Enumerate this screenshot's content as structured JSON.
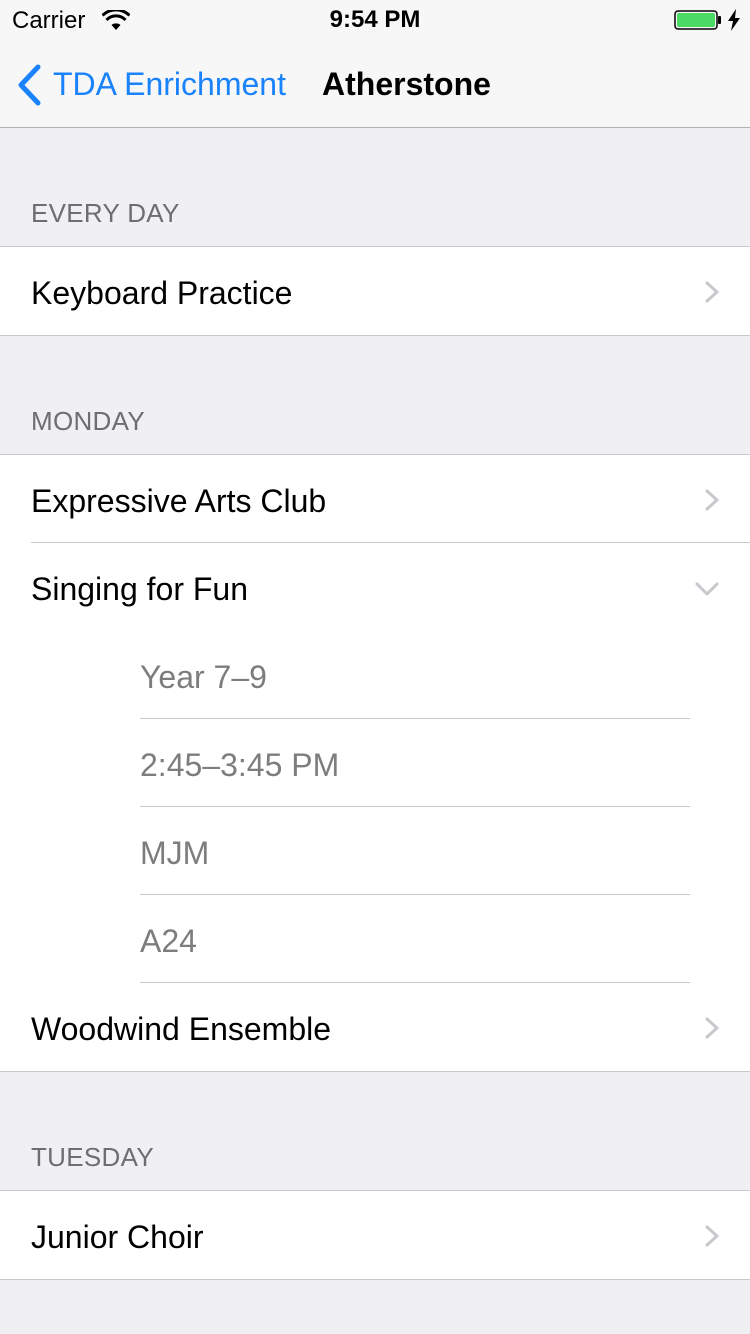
{
  "status_bar": {
    "carrier": "Carrier",
    "time": "9:54 PM",
    "battery_color": "#4cd964"
  },
  "nav": {
    "back_label": "TDA Enrichment",
    "title": "Atherstone",
    "accent_color": "#1a82fb"
  },
  "sections": [
    {
      "header": "EVERY DAY",
      "items": [
        {
          "label": "Keyboard Practice",
          "icon": "chevron-right-icon"
        }
      ]
    },
    {
      "header": "MONDAY",
      "items": [
        {
          "label": "Expressive Arts Club",
          "icon": "chevron-right-icon"
        },
        {
          "label": "Singing for Fun",
          "icon": "chevron-down-icon",
          "expanded": true,
          "details": [
            "Year 7–9",
            "2:45–3:45 PM",
            "MJM",
            "A24"
          ]
        },
        {
          "label": "Woodwind Ensemble",
          "icon": "chevron-right-icon"
        }
      ]
    },
    {
      "header": "TUESDAY",
      "items": [
        {
          "label": "Junior Choir",
          "icon": "chevron-right-icon"
        }
      ]
    }
  ]
}
